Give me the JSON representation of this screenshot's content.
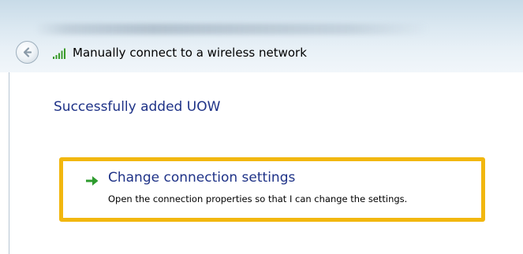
{
  "window": {
    "title": "Manually connect to a wireless network"
  },
  "icons": {
    "back": "back-arrow-icon",
    "network": "wireless-signal-icon",
    "option_arrow": "green-arrow-icon"
  },
  "main": {
    "heading": "Successfully added UOW",
    "option": {
      "title": "Change connection settings",
      "description": "Open the connection properties so that I can change the settings."
    }
  },
  "colors": {
    "heading": "#1e3287",
    "highlight_border": "#f2b70f",
    "arrow": "#2e9b2e",
    "signal": "#3a9a2a"
  }
}
